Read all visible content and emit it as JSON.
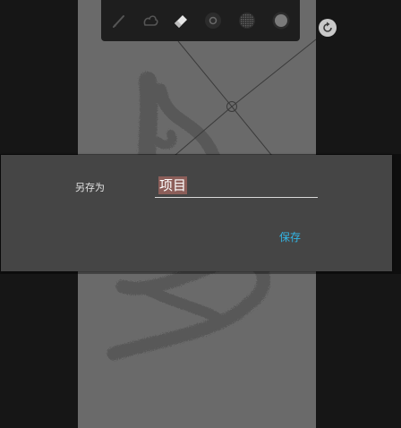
{
  "toolbar": {
    "tools": [
      {
        "id": "brush",
        "icon": "brush-icon"
      },
      {
        "id": "smudge",
        "icon": "smudge-icon"
      },
      {
        "id": "eraser",
        "icon": "eraser-icon",
        "active": true
      },
      {
        "id": "brush-size",
        "icon": "brush-size-icon"
      },
      {
        "id": "texture",
        "icon": "texture-icon"
      },
      {
        "id": "color",
        "icon": "color-swatch-icon"
      }
    ]
  },
  "canvas": {
    "rotate_icon": "rotate-icon",
    "background_color": "#6a6a6a"
  },
  "dialog": {
    "label": "另存为",
    "filename_value": "项目",
    "save_label": "保存"
  },
  "colors": {
    "accent": "#33b5e5",
    "dialog_bg": "#454545",
    "selection": "#8c5e59"
  }
}
